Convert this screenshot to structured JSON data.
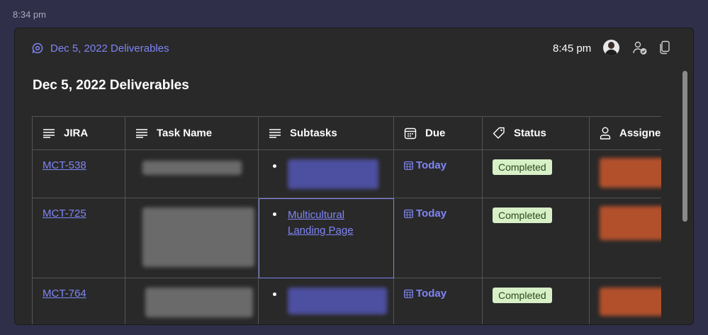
{
  "outer": {
    "time": "8:34 pm"
  },
  "card": {
    "header_title": "Dec 5, 2022 Deliverables",
    "time": "8:45 pm",
    "doc_title": "Dec 5, 2022 Deliverables"
  },
  "table": {
    "columns": [
      {
        "label": "JIRA",
        "icon": "text-lines-icon"
      },
      {
        "label": "Task Name",
        "icon": "text-lines-icon"
      },
      {
        "label": "Subtasks",
        "icon": "text-lines-icon"
      },
      {
        "label": "Due",
        "icon": "calendar-icon"
      },
      {
        "label": "Status",
        "icon": "tag-icon"
      },
      {
        "label": "Assigne",
        "icon": "person-icon"
      }
    ],
    "rows": [
      {
        "jira": "MCT-538",
        "subtask": "",
        "due": "Today",
        "status": "Completed"
      },
      {
        "jira": "MCT-725",
        "subtask": "Multicultural Landing Page",
        "due": "Today",
        "status": "Completed"
      },
      {
        "jira": "MCT-764",
        "subtask": "",
        "due": "Today",
        "status": "Completed"
      }
    ]
  },
  "colors": {
    "accent": "#7f85f5",
    "badge_bg": "#d8f0c8",
    "badge_text": "#2b4a1a",
    "card_bg": "#292929",
    "page_bg": "#2f2f4a"
  }
}
